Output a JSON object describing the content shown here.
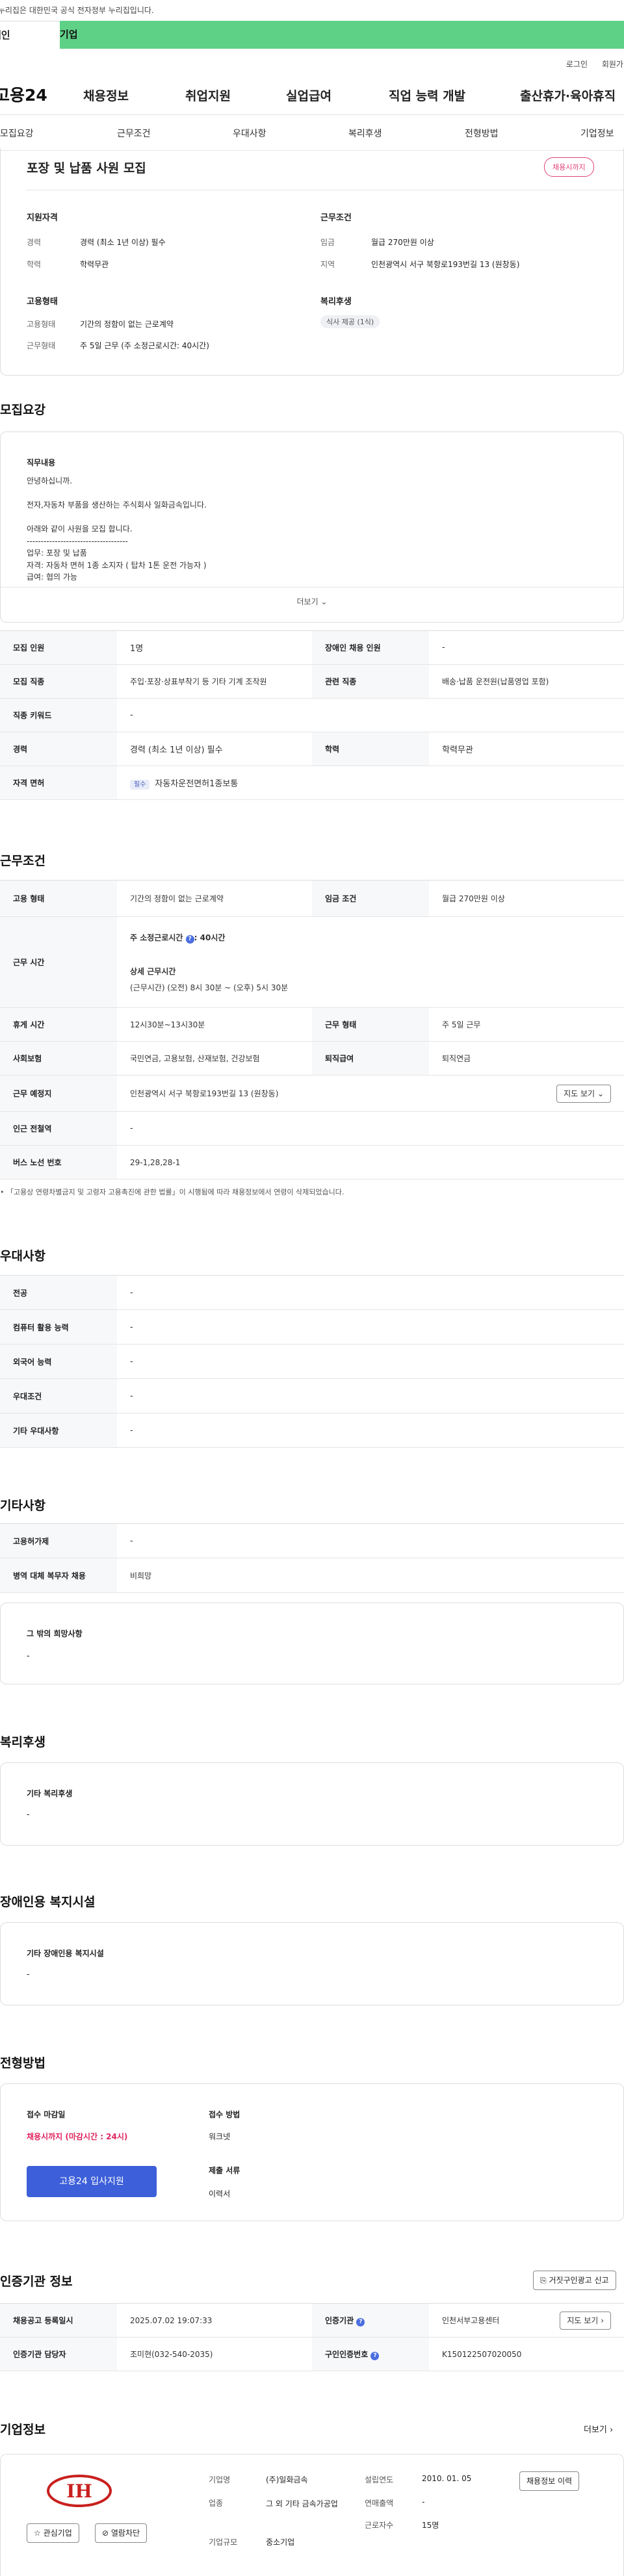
{
  "gov_banner": "이 누리집은 대한민국 공식 전자정부 누리집입니다.",
  "user_tabs": {
    "personal": "개인",
    "company": "기업"
  },
  "util": {
    "login": "로그인",
    "join": "회원가입"
  },
  "gnb": {
    "logo": "고용24",
    "items": [
      "채용정보",
      "취업지원",
      "실업급여",
      "직업 능력 개발",
      "출산휴가·육아휴직"
    ]
  },
  "subnav": [
    "모집요강",
    "근무조건",
    "우대사항",
    "복리후생",
    "전형방법",
    "기업정보"
  ],
  "summary": {
    "title": "포장 및 납품 사원 모집",
    "status": "채용시까지",
    "qual_title": "지원자격",
    "qual": [
      {
        "k": "경력",
        "v": "경력 (최소 1년 이상) 필수"
      },
      {
        "k": "학력",
        "v": "학력무관"
      }
    ],
    "emp_title": "고용형태",
    "emp": [
      {
        "k": "고용형태",
        "v": "기간의 정함이 없는 근로계약"
      },
      {
        "k": "근무형태",
        "v": "주 5일 근무 (주 소정근로시간: 40시간)"
      }
    ],
    "cond_title": "근무조건",
    "cond": [
      {
        "k": "임금",
        "v": "월급 270만원 이상"
      },
      {
        "k": "지역",
        "v": "인천광역시 서구 북항로193번길 13 (원창동)"
      }
    ],
    "welfare_title": "복리후생",
    "welfare_badge": "식사 제공 (1식)"
  },
  "recruit": {
    "title": "모집요강",
    "duty_title": "직무내용",
    "lines": [
      "안녕하십니까.",
      "",
      "전자,자동차 부품을 생산하는 주식회사 일화금속입니다.",
      "",
      "아래와 같이 사원을 모집 합니다.",
      "------------------------------------",
      "업무: 포장 및 납품",
      "자격: 자동차 면허 1종 소지자 ( 탑차 1톤 운전 가능자 )",
      "급여: 협의 가능"
    ],
    "more": "더보기",
    "rows": [
      [
        {
          "k": "모집 인원",
          "v": "1명"
        },
        {
          "k": "장애인 채용 인원",
          "v": "-"
        }
      ],
      [
        {
          "k": "모집 직종",
          "v": "주입·포장·상표부착기 등 기타 기계 조작원"
        },
        {
          "k": "관련 직종",
          "v": "배송·납품 운전원(납품영업 포함)"
        }
      ],
      [
        {
          "k": "직종 키워드",
          "v": "-"
        }
      ],
      [
        {
          "k": "경력",
          "v": "경력 (최소 1년 이상) 필수"
        },
        {
          "k": "학력",
          "v": "학력무관"
        }
      ],
      [
        {
          "k": "자격 면허",
          "v": "자동차운전면허1종보통",
          "tag": "필수"
        }
      ]
    ]
  },
  "work": {
    "title": "근무조건",
    "emp_type_k": "고용 형태",
    "emp_type_v": "기간의 정함이 없는 근로계약",
    "wage_k": "임금 조건",
    "wage_v": "월급 270만원 이상",
    "hours_k": "근무 시간",
    "hours_weekly": "주 소정근로시간",
    "hours_weekly_v": ": 40시간",
    "hours_detail_title": "상세 근무시간",
    "hours_detail": "(근무시간) (오전) 8시 30분 ~ (오후) 5시 30분",
    "break_k": "휴게 시간",
    "break_v": "12시30분~13시30분",
    "form_k": "근무 형태",
    "form_v": "주 5일 근무",
    "ins_k": "사회보험",
    "ins_v": "국민연금, 고용보험, 산재보험, 건강보험",
    "ret_k": "퇴직급여",
    "ret_v": "퇴직연금",
    "place_k": "근무 예정지",
    "place_v": "인천광역시 서구 북항로193번길 13 (원창동)",
    "map_btn": "지도 보기",
    "subway_k": "인근 전철역",
    "subway_v": "-",
    "bus_k": "버스 노선 번호",
    "bus_v": "29-1,28,28-1",
    "note": "「고용상 연령차별금지 및 고령자 고용촉진에 관한 법률」이 시행됨에 따라 채용정보에서 연령이 삭제되었습니다."
  },
  "pref": {
    "title": "우대사항",
    "rows": [
      {
        "k": "전공",
        "v": "-"
      },
      {
        "k": "컴퓨터 활용 능력",
        "v": "-"
      },
      {
        "k": "외국어 능력",
        "v": "-"
      },
      {
        "k": "우대조건",
        "v": "-"
      },
      {
        "k": "기타 우대사항",
        "v": "-"
      }
    ]
  },
  "etc": {
    "title": "기타사항",
    "rows": [
      {
        "k": "고용허가제",
        "v": "-"
      },
      {
        "k": "병역 대체 복무자 채용",
        "v": "비희망"
      }
    ],
    "other_title": "그 밖의 희망사항",
    "other_v": "-"
  },
  "welfare": {
    "title": "복리후생",
    "box_title": "기타 복리후생",
    "box_v": "-"
  },
  "disabled": {
    "title": "장애인용 복지시설",
    "box_title": "기타 장애인용 복지시설",
    "box_v": "-"
  },
  "selection": {
    "title": "전형방법",
    "deadline_k": "접수 마감일",
    "deadline_v": "채용시까지 (마감시간 : 24시)",
    "apply_btn": "고용24 입사지원",
    "method_k": "접수 방법",
    "method_v": "워크넷",
    "docs_k": "제출 서류",
    "docs_v": "이력서"
  },
  "agency": {
    "title": "인증기관 정보",
    "report_btn": "거짓구인광고 신고",
    "reg_k": "채용공고 등록일시",
    "reg_v": "2025.07.02 19:07:33",
    "org_k": "인증기관",
    "org_v": "인천서부고용센터",
    "map_btn": "지도 보기",
    "mgr_k": "인증기관 담당자",
    "mgr_v": "조미현(032-540-2035)",
    "no_k": "구인인증번호",
    "no_v": "K150122507020050"
  },
  "company": {
    "title": "기업정보",
    "more": "더보기",
    "logo_text": "IH",
    "fav_btn": "관심기업",
    "block_btn": "열람차단",
    "name_k": "기업명",
    "name_v": "(주)일화금속",
    "ind_k": "업종",
    "ind_v": "그 외 기타 금속가공업",
    "size_k": "기업규모",
    "size_v": "중소기업",
    "est_k": "설립연도",
    "est_v": "2010. 01. 05",
    "sales_k": "연매출액",
    "sales_v": "-",
    "emp_k": "근로자수",
    "emp_v": "15명",
    "history_btn": "채용정보 이력"
  }
}
